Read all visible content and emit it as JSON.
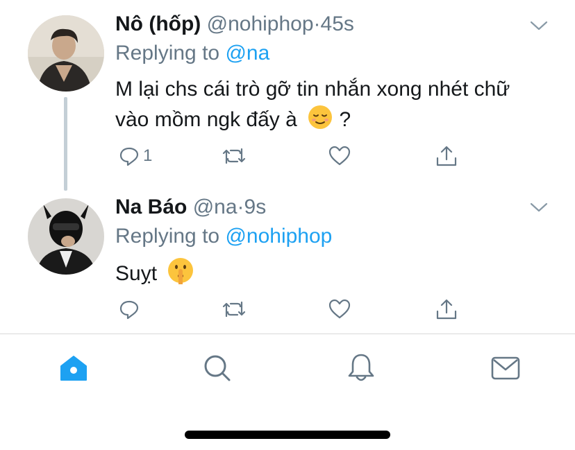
{
  "tweets": [
    {
      "name": "Nô (hốp)",
      "handle": "@nohiphop",
      "dot": "·",
      "time": "45s",
      "replying_prefix": "Replying to ",
      "replying_to": "@na",
      "text_line1": "M lại chs cái trò gỡ tin nhắn xong nhét chữ",
      "text_line2": "vào mồm ngk đấy à",
      "text_suffix": "?",
      "emoji": "relieved-face",
      "reply_count": "1"
    },
    {
      "name": "Na Báo",
      "handle": "@na",
      "dot": "·",
      "time": "9s",
      "replying_prefix": "Replying to ",
      "replying_to": "@nohiphop",
      "text_line1": "Suỵt",
      "emoji": "shushing-face",
      "reply_count": ""
    }
  ],
  "tabs": [
    "home",
    "search",
    "notifications",
    "messages"
  ],
  "colors": {
    "accent": "#1da1f2",
    "secondary_text": "#657786",
    "icon": "#657786",
    "thread_line": "#c4cfd6"
  }
}
